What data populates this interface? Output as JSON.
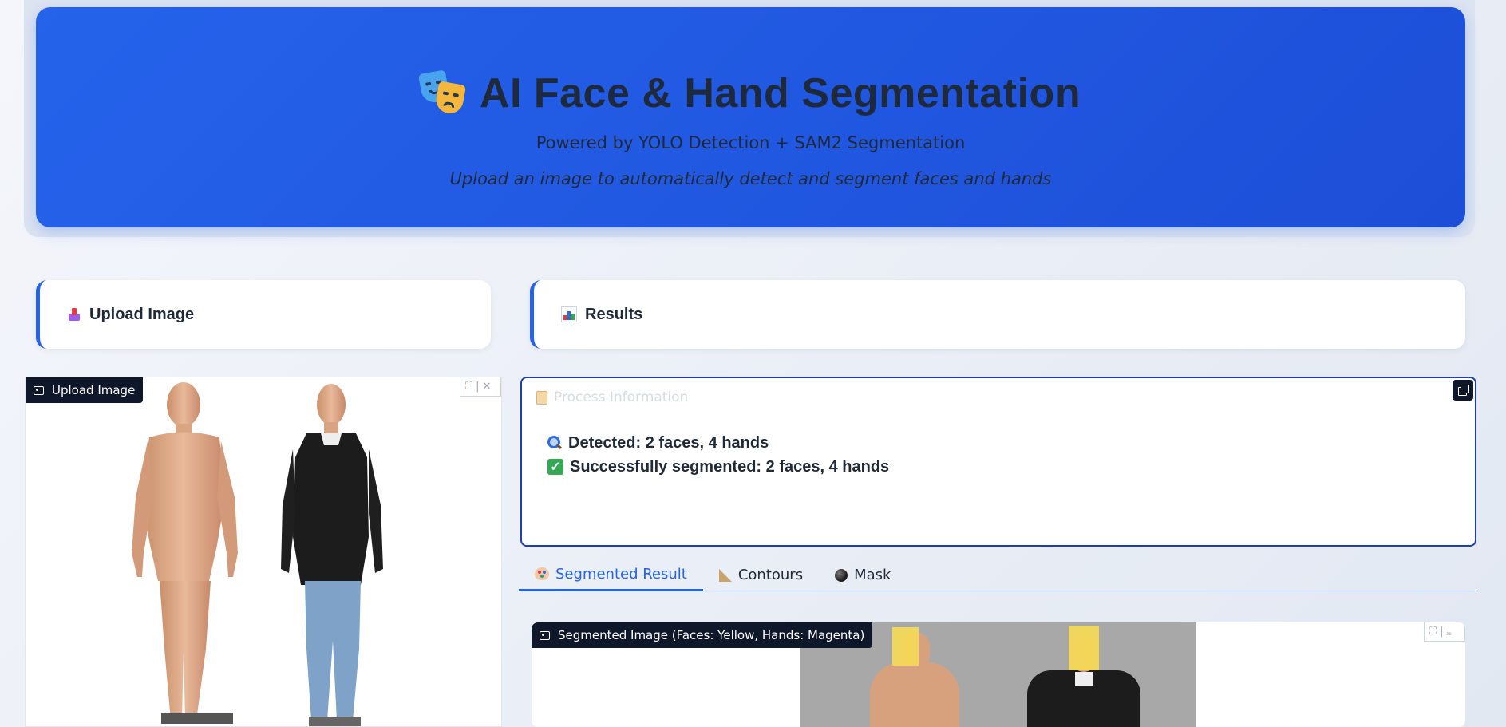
{
  "header": {
    "title": "AI Face & Hand Segmentation",
    "subtitle": "Powered by YOLO Detection + SAM2 Segmentation",
    "description": "Upload an image to automatically detect and segment faces and hands",
    "icon": "performing-arts-masks-icon"
  },
  "sections": {
    "upload_heading": "Upload Image",
    "results_heading": "Results"
  },
  "upload_panel": {
    "label": "Upload Image"
  },
  "process_info": {
    "title": "Process Information",
    "lines": [
      "Detected: 2 faces, 4 hands",
      "Successfully segmented: 2 faces, 4 hands"
    ]
  },
  "tabs": [
    {
      "label": "Segmented Result",
      "active": true,
      "icon": "palette-icon"
    },
    {
      "label": "Contours",
      "active": false,
      "icon": "triangular-ruler-icon"
    },
    {
      "label": "Mask",
      "active": false,
      "icon": "black-circle-icon"
    }
  ],
  "result_panel": {
    "label": "Segmented Image (Faces: Yellow, Hands: Magenta)"
  },
  "colors": {
    "accent": "#2563eb",
    "header_bg": "#2563eb",
    "dark_label": "#0f172a",
    "face_highlight": "#f6da56"
  }
}
